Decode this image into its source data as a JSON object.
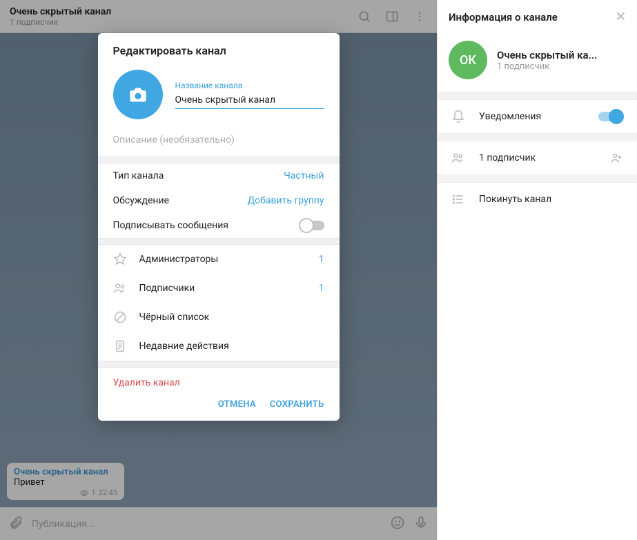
{
  "header": {
    "title": "Очень скрытый канал",
    "subscribers": "1 подписчик"
  },
  "message": {
    "author": "Очень скрытый канал",
    "text": "Привет",
    "views": "1",
    "time": "22:45"
  },
  "composer": {
    "placeholder": "Публикация..."
  },
  "modal": {
    "title": "Редактировать канал",
    "name_label": "Название канала",
    "name_value": "Очень скрытый канал",
    "desc_placeholder": "Описание (необязательно)",
    "type_label": "Тип канала",
    "type_value": "Частный",
    "discussion_label": "Обсуждение",
    "discussion_value": "Добавить группу",
    "sign_label": "Подписывать сообщения",
    "admins": {
      "label": "Администраторы",
      "count": "1"
    },
    "subs": {
      "label": "Подписчики",
      "count": "1"
    },
    "blacklist": "Чёрный список",
    "recent": "Недавние действия",
    "delete": "Удалить канал",
    "cancel": "ОТМЕНА",
    "save": "СОХРАНИТЬ"
  },
  "info": {
    "title": "Информация о канале",
    "avatar_letters": "ОК",
    "name": "Очень скрытый ка...",
    "sub": "1 подписчик",
    "notifications": "Уведомления",
    "one_sub": "1 подписчик",
    "leave": "Покинуть канал"
  }
}
